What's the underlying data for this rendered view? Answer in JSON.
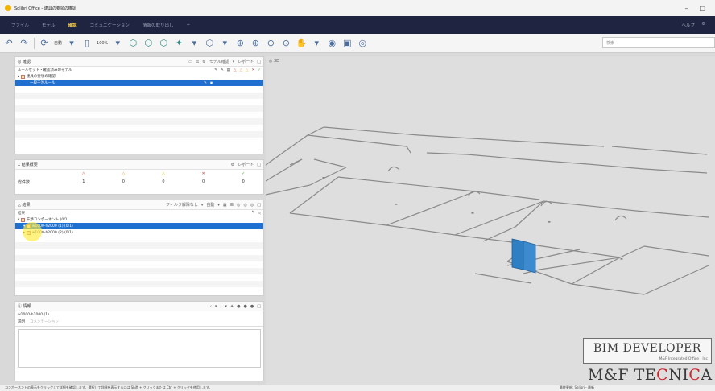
{
  "window": {
    "title": "Solibri Office - 建具の要領の確認",
    "buttons": [
      "–",
      "□"
    ]
  },
  "ribbon": {
    "tabs": [
      {
        "label": "ファイル",
        "active": false
      },
      {
        "label": "モデル",
        "active": false
      },
      {
        "label": "確認",
        "active": true
      },
      {
        "label": "コミュニケーション",
        "active": false
      },
      {
        "label": "情報の取り出し",
        "active": false
      },
      {
        "label": "+",
        "active": false
      }
    ],
    "right_label": "ヘルプ"
  },
  "toolbar": {
    "label_1": "自動",
    "label_2": "100%",
    "search_placeholder": "検索"
  },
  "check_panel": {
    "title": "確認",
    "toolbar_label_model_check": "モデル確認",
    "toolbar_label_report": "レポート",
    "header_label": "ルールセット・確認済みのモデル",
    "rows": [
      {
        "label": "建具の要領の確認",
        "level": 0
      },
      {
        "label": "一般干渉ルール",
        "level": 1,
        "selected": true
      }
    ]
  },
  "summary_panel": {
    "title": "結果概要",
    "report_label": "レポート",
    "row_label": "総件数",
    "values": [
      "1",
      "0",
      "0",
      "0",
      "0"
    ]
  },
  "results_panel": {
    "title": "結果",
    "toolbar_label_filter": "フィルタ解除なし",
    "toolbar_label_auto": "自動",
    "header_label": "結果",
    "rows": [
      {
        "label": "干渉コンポーネント (0/1)",
        "level": 0,
        "selected": false
      },
      {
        "label": "w1000-h2000 (1) (0/1)",
        "level": 1,
        "selected": true
      },
      {
        "label": "w1000-h2000 (2) (0/1)",
        "level": 1,
        "selected": false
      }
    ]
  },
  "info_panel": {
    "title": "情報",
    "item_label": "w1000-h1000 (1)",
    "tabs": [
      {
        "label": "説明",
        "active": true
      },
      {
        "label": "コメンテーション",
        "active": false
      }
    ]
  },
  "viewport": {
    "title": "3D",
    "element_color": "#2f7fc4"
  },
  "statusbar": {
    "left_text": "コンポーネントの表示をクリックして詳細を確認します。選択して詳細を表示するには Shift + クリックまたは Ctrl + クリックを使用します。",
    "right_text": "最終更新: Solibri - 最新"
  },
  "watermark": {
    "title": "BIM DEVELOPER",
    "subtitle": "M&F Integrated Office , Inc",
    "logo_left": "M&F TE",
    "logo_red": "C",
    "logo_mid": "NI",
    "logo_red2": "C",
    "logo_right": "A"
  }
}
